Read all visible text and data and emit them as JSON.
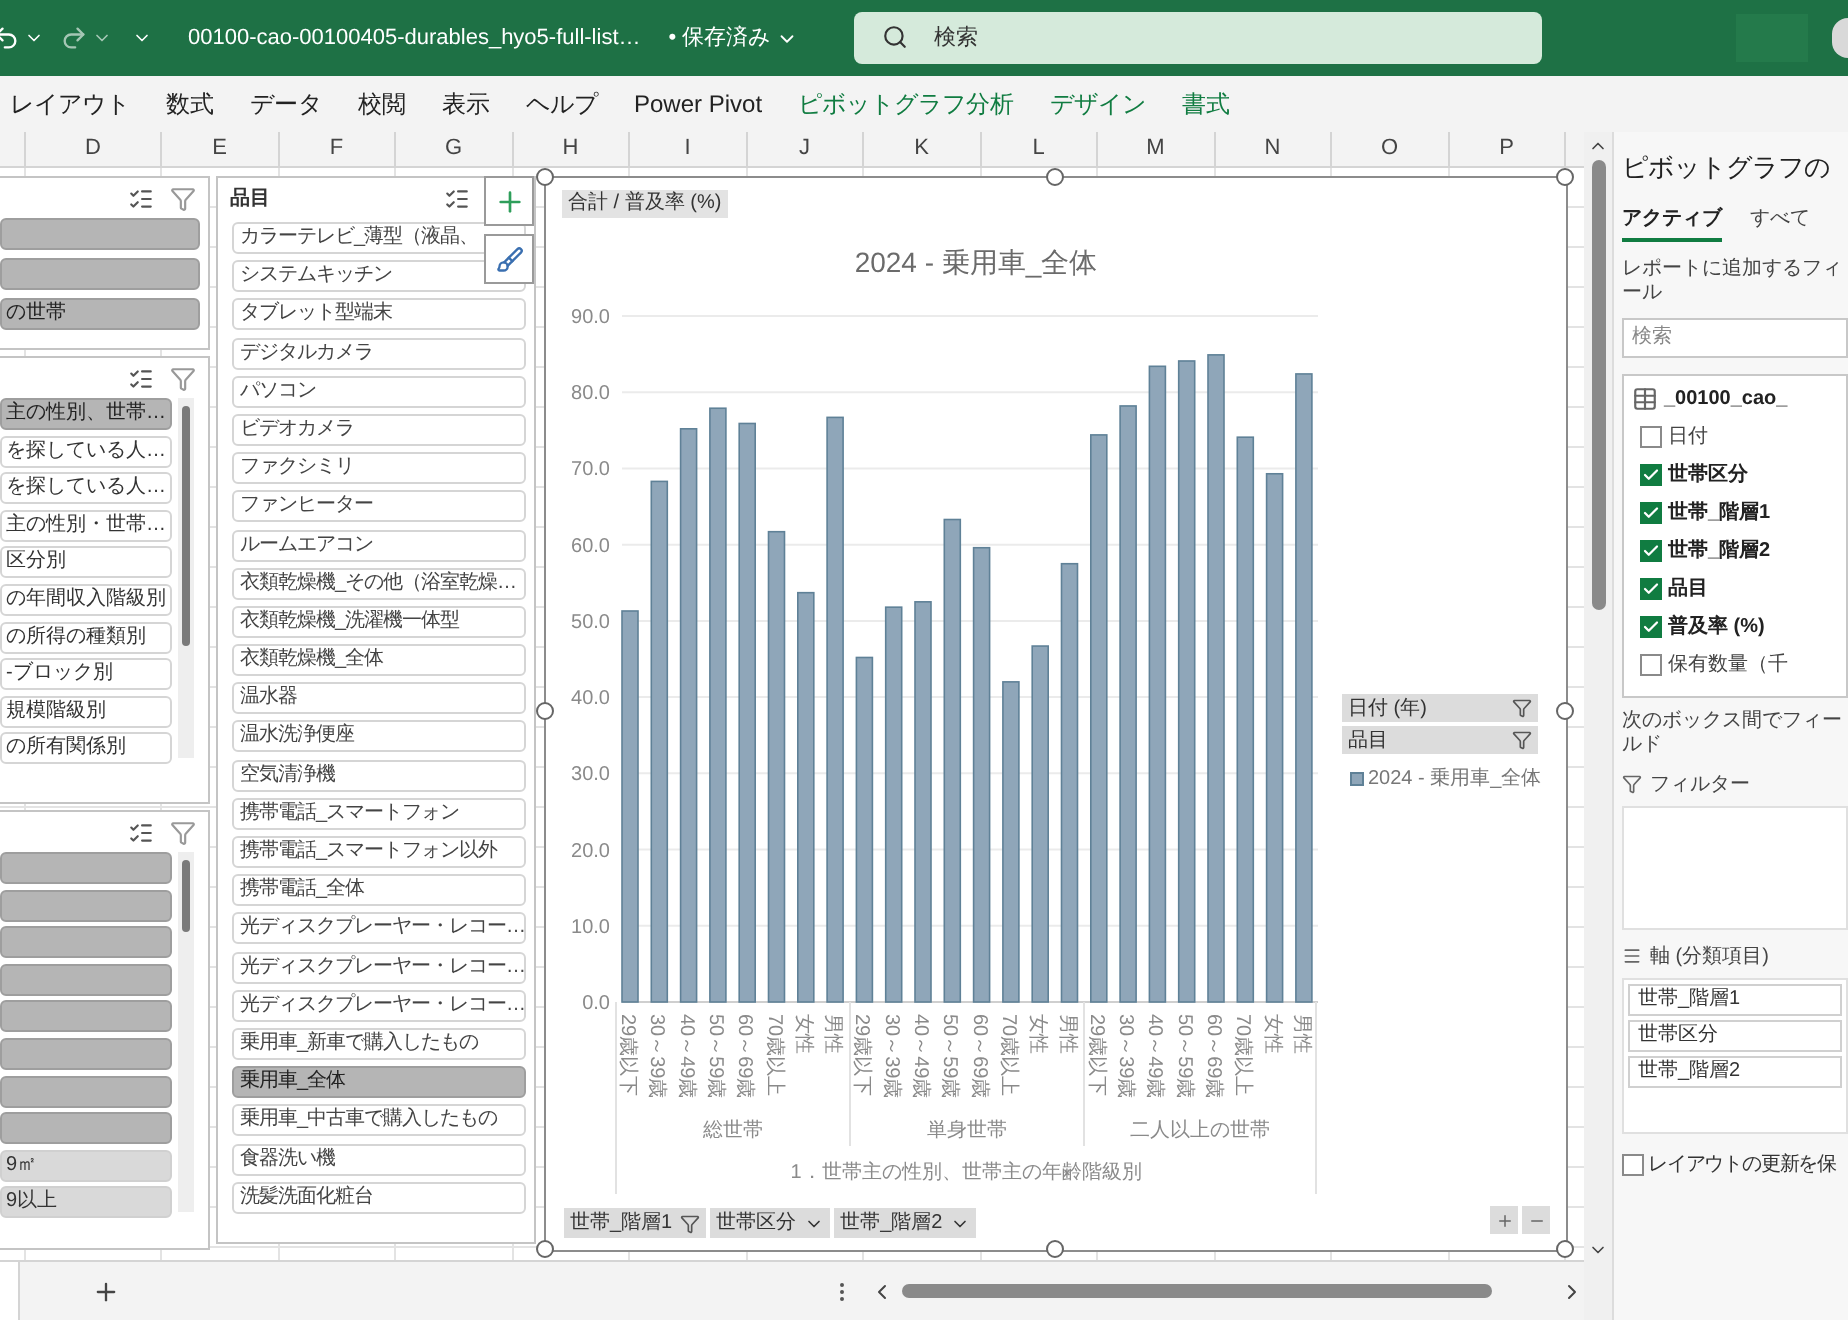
{
  "title_bar": {
    "file_name": "00100-cao-00100405-durables_hyo5-full-list…",
    "save_status": "• 保存済み",
    "search": {
      "placeholder": "検索"
    }
  },
  "ribbon_tabs": [
    {
      "label": "レイアウト",
      "kind": "standard"
    },
    {
      "label": "数式",
      "kind": "standard"
    },
    {
      "label": "データ",
      "kind": "standard"
    },
    {
      "label": "校閲",
      "kind": "standard"
    },
    {
      "label": "表示",
      "kind": "standard"
    },
    {
      "label": "ヘルプ",
      "kind": "standard"
    },
    {
      "label": "Power Pivot",
      "kind": "standard"
    },
    {
      "label": "ピボットグラフ分析",
      "kind": "contextual"
    },
    {
      "label": "デザイン",
      "kind": "contextual"
    },
    {
      "label": "書式",
      "kind": "contextual"
    }
  ],
  "columns": [
    "D",
    "E",
    "F",
    "G",
    "H",
    "I",
    "J",
    "K",
    "L",
    "M",
    "N",
    "O",
    "P"
  ],
  "slicers": [
    {
      "items": [
        {
          "selected": true
        },
        {
          "selected": true
        },
        {
          "label": "の世帯",
          "selected": true
        }
      ]
    },
    {
      "items": [
        {
          "label": "主の性別、世帯…",
          "selected": true
        },
        {
          "label": "を探している人…",
          "selected": false
        },
        {
          "label": "を探している人…",
          "selected": false
        },
        {
          "label": "主の性別・世帯…",
          "selected": false
        },
        {
          "label": "区分別",
          "selected": false
        },
        {
          "label": "の年間収入階級別",
          "selected": false
        },
        {
          "label": "の所得の種類別",
          "selected": false
        },
        {
          "label": "-ブロック別",
          "selected": false
        },
        {
          "label": "規模階級別",
          "selected": false
        },
        {
          "label": "の所有関係別",
          "selected": false
        }
      ]
    },
    {
      "items": [
        {
          "selected": true,
          "has_data": true
        },
        {
          "selected": true,
          "has_data": true
        },
        {
          "selected": true,
          "has_data": true
        },
        {
          "selected": true,
          "has_data": true
        },
        {
          "selected": true,
          "has_data": true
        },
        {
          "selected": true,
          "has_data": true
        },
        {
          "selected": true,
          "has_data": true
        },
        {
          "selected": true,
          "has_data": true
        },
        {
          "label": "9㎡",
          "selected": true,
          "has_data": false
        },
        {
          "label": "9以上",
          "selected": true,
          "has_data": false
        }
      ]
    }
  ],
  "item_slicer": {
    "title": "品目",
    "items": [
      {
        "label": "カラーテレビ_薄型（液晶、",
        "selected": false
      },
      {
        "label": "システムキッチン",
        "selected": false
      },
      {
        "label": "タブレット型端末",
        "selected": false
      },
      {
        "label": "デジタルカメラ",
        "selected": false
      },
      {
        "label": "パソコン",
        "selected": false
      },
      {
        "label": "ビデオカメラ",
        "selected": false
      },
      {
        "label": "ファクシミリ",
        "selected": false
      },
      {
        "label": "ファンヒーター",
        "selected": false
      },
      {
        "label": "ルームエアコン",
        "selected": false
      },
      {
        "label": "衣類乾燥機_その他（浴室乾燥…",
        "selected": false
      },
      {
        "label": "衣類乾燥機_洗濯機一体型",
        "selected": false
      },
      {
        "label": "衣類乾燥機_全体",
        "selected": false
      },
      {
        "label": "温水器",
        "selected": false
      },
      {
        "label": "温水洗浄便座",
        "selected": false
      },
      {
        "label": "空気清浄機",
        "selected": false
      },
      {
        "label": "携帯電話_スマートフォン",
        "selected": false
      },
      {
        "label": "携帯電話_スマートフォン以外",
        "selected": false
      },
      {
        "label": "携帯電話_全体",
        "selected": false
      },
      {
        "label": "光ディスクプレーヤー・レコー…",
        "selected": false
      },
      {
        "label": "光ディスクプレーヤー・レコー…",
        "selected": false
      },
      {
        "label": "光ディスクプレーヤー・レコー…",
        "selected": false
      },
      {
        "label": "乗用車_新車で購入したもの",
        "selected": false
      },
      {
        "label": "乗用車_全体",
        "selected": true
      },
      {
        "label": "乗用車_中古車で購入したもの",
        "selected": false
      },
      {
        "label": "食器洗い機",
        "selected": false
      },
      {
        "label": "洗髪洗面化粧台",
        "selected": false
      }
    ]
  },
  "chart": {
    "field_label": "合計 / 普及率 (%)",
    "filter_buttons": [
      {
        "label": "日付 (年)",
        "filtered": true
      },
      {
        "label": "品目",
        "filtered": true
      }
    ],
    "axis_buttons": [
      {
        "label": "世帯_階層1",
        "filtered": true
      },
      {
        "label": "世帯区分",
        "filtered": false
      },
      {
        "label": "世帯_階層2",
        "filtered": false
      }
    ],
    "groups": [
      "総世帯",
      "単身世帯",
      "二人以上の世帯"
    ],
    "chart_data": {
      "type": "bar",
      "grid": true,
      "title": "2024 - 乗用車_全体",
      "xlabel": "1．世帯主の性別、世帯主の年齢階級別",
      "categories": [
        "29歳以下",
        "30～39歳",
        "40～49歳",
        "50～59歳",
        "60～69歳",
        "70歳以上",
        "女性",
        "男性",
        "29歳以下",
        "30～39歳",
        "40～49歳",
        "50～59歳",
        "60～69歳",
        "70歳以上",
        "女性",
        "男性",
        "29歳以下",
        "30～39歳",
        "40～49歳",
        "50～59歳",
        "60～69歳",
        "70歳以上",
        "女性",
        "男性"
      ],
      "series": [
        {
          "name": "2024 - 乗用車_全体",
          "color": "#8fa6b9",
          "values": [
            51.3,
            68.3,
            75.2,
            77.9,
            75.9,
            61.7,
            53.7,
            76.7,
            45.2,
            51.8,
            52.5,
            63.3,
            59.6,
            42.0,
            46.7,
            57.5,
            74.4,
            78.2,
            83.4,
            84.1,
            84.9,
            74.1,
            69.3,
            82.4
          ]
        }
      ],
      "ylim": [
        0,
        90
      ],
      "yticks": [
        {
          "value": 0,
          "label": "0.0"
        },
        {
          "value": 10,
          "label": "10.0"
        },
        {
          "value": 20,
          "label": "20.0"
        },
        {
          "value": 30,
          "label": "30.0"
        },
        {
          "value": 40,
          "label": "40.0"
        },
        {
          "value": 50,
          "label": "50.0"
        },
        {
          "value": 60,
          "label": "60.0"
        },
        {
          "value": 70,
          "label": "70.0"
        },
        {
          "value": 80,
          "label": "80.0"
        },
        {
          "value": 90,
          "label": "90.0"
        }
      ]
    }
  },
  "field_pane": {
    "title": "ピボットグラフの",
    "tabs": [
      {
        "label": "アクティブ",
        "selected": true
      },
      {
        "label": "すべて",
        "selected": false
      }
    ],
    "instruction": "レポートに追加するフィール",
    "search": {
      "placeholder": "検索"
    },
    "table_name": "_00100_cao_",
    "fields": [
      {
        "label": "日付",
        "checked": false
      },
      {
        "label": "世帯区分",
        "checked": true
      },
      {
        "label": "世帯_階層1",
        "checked": true
      },
      {
        "label": "世帯_階層2",
        "checked": true
      },
      {
        "label": "品目",
        "checked": true
      },
      {
        "label": "普及率 (%)",
        "checked": true
      },
      {
        "label": "保有数量（千",
        "checked": false
      }
    ],
    "areas_instruction": "次のボックス間でフィールド",
    "filters_label": "フィルター",
    "axis_label": "軸 (分類項目)",
    "axis_fields": [
      "世帯_階層1",
      "世帯区分",
      "世帯_階層2"
    ],
    "defer_update": {
      "label": "レイアウトの更新を保",
      "checked": false
    }
  }
}
